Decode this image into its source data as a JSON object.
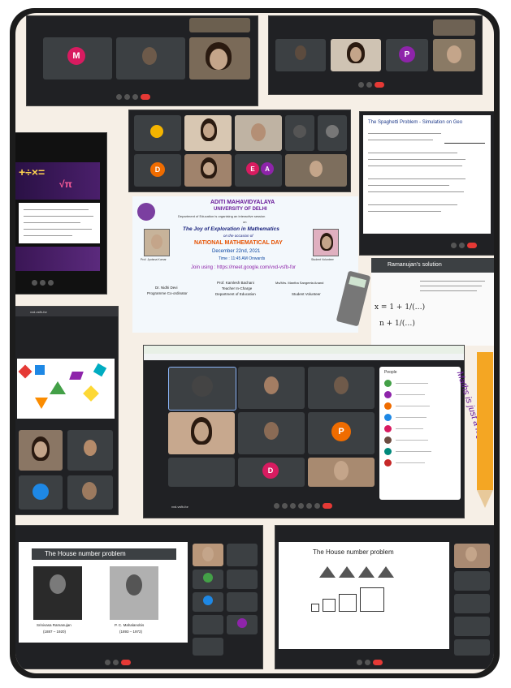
{
  "poster": {
    "college": "ADITI MAHAVIDYALAYA",
    "university": "UNIVERSITY OF DELHI",
    "dept_line": "Department of Education is organising an interactive session",
    "on": "on",
    "title": "The Joy of Exploration in Mathematics",
    "occasion": "on the occasion of",
    "day": "NATIONAL MATHEMATICAL DAY",
    "date": "December 22nd, 2021",
    "time": "Time : 11:45 AM Onwards",
    "join": "Join using : https://meet.google.com/vxd-vsfb-for",
    "person1_name": "Dr. Nidhi Devi",
    "person1_role": "Programme Co-ordinator",
    "person2_name": "Prof. Kamlesh Bachani",
    "person2_role": "Teacher In-Charge",
    "person2_dept": "Department of Education",
    "person3_name": "Ms/Mrs. Mantha Sangeeta Anand",
    "person3_role": "Student Volunteer",
    "speaker_caption": "Prof. Jyotsna Kumar",
    "volunteer_caption": "Student Volunteer"
  },
  "slides": {
    "spaghetti_title": "The Spaghetti Problem - Simulation on Geo",
    "ramanujan_title": "Ramanujan's solution",
    "house_title_left": "The House number problem",
    "house_title_right": "The House number problem",
    "caption_left_1": "Srinivasa Ramanujan",
    "caption_left_1_years": "(1887 – 1920)",
    "caption_left_2": "P. C. Mahalanobis",
    "caption_left_2_years": "(1893 – 1972)",
    "side_text": "Maths is just a logic!"
  },
  "meet": {
    "url": "vxd-vsfb-for",
    "people_header": "People",
    "avatar_m": "M",
    "avatar_p": "P",
    "avatar_d": "D",
    "avatar_e": "E",
    "avatar_a": "A"
  },
  "colors": {
    "frame": "#1c1c1c",
    "meet_bg": "#2b2d31",
    "end_call": "#e53935",
    "avatar_pink": "#d81b60",
    "avatar_orange": "#ef6c00",
    "avatar_purple": "#8e24aa",
    "avatar_green": "#43a047",
    "pencil": "#f4a623"
  }
}
